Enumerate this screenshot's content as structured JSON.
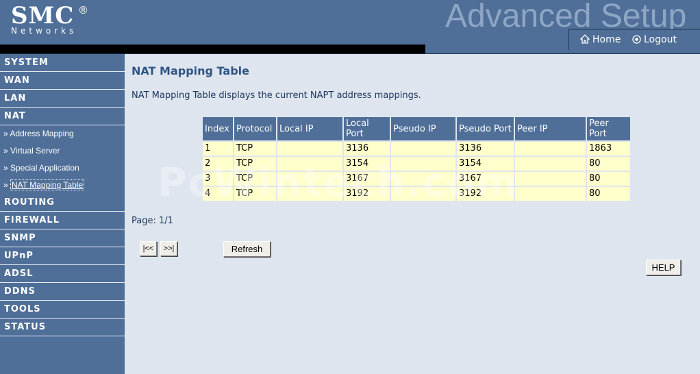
{
  "header": {
    "brand": "SMC",
    "brand_mark": "®",
    "brand_sub": "Networks",
    "title": "Advanced Setup",
    "home_label": "Home",
    "logout_label": "Logout"
  },
  "sidebar": {
    "items": [
      {
        "label": "SYSTEM",
        "type": "category"
      },
      {
        "label": "WAN",
        "type": "category"
      },
      {
        "label": "LAN",
        "type": "category"
      },
      {
        "label": "NAT",
        "type": "category"
      },
      {
        "label": "» Address Mapping",
        "type": "sub"
      },
      {
        "label": "» Virtual Server",
        "type": "sub"
      },
      {
        "label": "» Special Application",
        "type": "sub"
      },
      {
        "label": "NAT Mapping Table",
        "prefix": "» ",
        "type": "sub",
        "active": true
      },
      {
        "label": "ROUTING",
        "type": "category"
      },
      {
        "label": "FIREWALL",
        "type": "category"
      },
      {
        "label": "SNMP",
        "type": "category"
      },
      {
        "label": "UPnP",
        "type": "category"
      },
      {
        "label": "ADSL",
        "type": "category"
      },
      {
        "label": "DDNS",
        "type": "category"
      },
      {
        "label": "TOOLS",
        "type": "category"
      },
      {
        "label": "STATUS",
        "type": "category"
      }
    ]
  },
  "main": {
    "title": "NAT Mapping Table",
    "description": "NAT Mapping Table displays the current NAPT address mappings.",
    "table": {
      "headers": [
        "Index",
        "Protocol",
        "Local IP",
        "Local Port",
        "Pseudo IP",
        "Pseudo Port",
        "Peer IP",
        "Peer Port"
      ],
      "rows": [
        [
          "1",
          "TCP",
          "",
          "3136",
          "",
          "3136",
          "",
          "1863"
        ],
        [
          "2",
          "TCP",
          "",
          "3154",
          "",
          "3154",
          "",
          "80"
        ],
        [
          "3",
          "TCP",
          "",
          "3167",
          "",
          "3167",
          "",
          "80"
        ],
        [
          "4",
          "TCP",
          "",
          "3192",
          "",
          "3192",
          "",
          "80"
        ]
      ]
    },
    "page_label": "Page:",
    "page_value": "1/1",
    "first_label": "|<<",
    "last_label": ">>|",
    "refresh_label": "Refresh",
    "help_label": "HELP"
  },
  "watermark": "PcWintech.com",
  "colors": {
    "header_bg": "#4f6f98",
    "sidebar_bg": "#4f6f98",
    "content_bg": "#dfe5ee",
    "row_bg": "#ffffcc",
    "title_color": "#2d5584"
  }
}
